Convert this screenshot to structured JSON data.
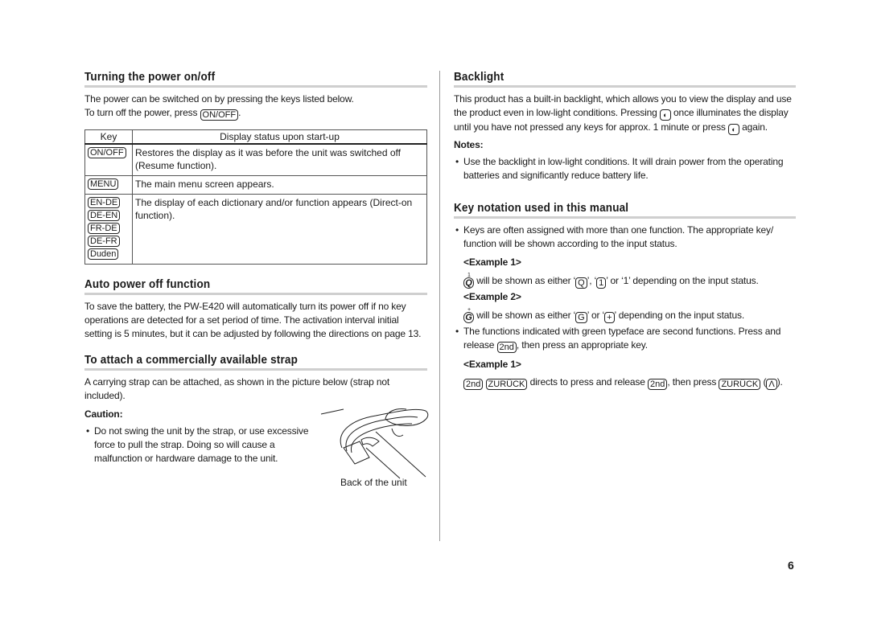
{
  "page_number": "6",
  "left": {
    "power": {
      "title": "Turning the power on/off",
      "line1": "The power can be switched on by pressing the keys listed below.",
      "line2_prefix": "To turn off the power, press",
      "line2_key": "ON/OFF",
      "line2_suffix": ".",
      "table": {
        "headers": [
          "Key",
          "Display status upon start-up"
        ],
        "rows": [
          {
            "keys": [
              "ON/OFF"
            ],
            "text": "Restores the display as it was before the unit was switched off (Resume function)."
          },
          {
            "keys": [
              "MENU"
            ],
            "text": "The main menu screen appears."
          },
          {
            "keys": [
              "EN-DE",
              "DE-EN",
              "FR-DE",
              "DE-FR",
              "Duden"
            ],
            "text": "The display of each dictionary and/or function appears (Direct-on function)."
          }
        ]
      }
    },
    "auto_off": {
      "title": "Auto power off function",
      "text": "To save the battery, the PW-E420 will automatically turn its power off if no key operations are detected for a set period of time. The activation interval initial setting is 5 minutes, but it can be adjusted by following the directions on page 13."
    },
    "strap": {
      "title": "To attach a commercially available strap",
      "text": "A carrying strap can be attached, as shown in the picture below (strap not included).",
      "caution_label": "Caution:",
      "caution_text": "Do not swing the unit by the strap, or use excessive force to pull the strap. Doing so will cause a malfunction or hardware damage to the unit.",
      "caption": "Back of the unit"
    }
  },
  "right": {
    "backlight": {
      "title": "Backlight",
      "p1": "This product has a built-in backlight, which allows you to view the display and use",
      "p2_prefix": "the product even in low-light conditions. Pressing",
      "p2_suffix": "once illuminates the display",
      "p3_prefix": "until you have not pressed any keys for approx. 1 minute or press",
      "p3_suffix": "again.",
      "notes_label": "Notes:",
      "note1": "Use the backlight in low-light conditions. It will drain power from the operating batteries and significantly reduce battery life."
    },
    "notation": {
      "title": "Key notation used in this manual",
      "bullet1": "Keys are often assigned with more than one function. The appropriate key/ function will be shown according to the input status.",
      "example1_label": "<Example 1>",
      "ex1_key": "Q",
      "ex1_sup": "1",
      "ex1_a": "will be shown as either ‘",
      "ex1_key2": "Q",
      "ex1_b": "’, ‘",
      "ex1_key3": "1",
      "ex1_c": "’ or ‘1’ depending on the input status.",
      "example2_label": "<Example 2>",
      "ex2_key": "G",
      "ex2_sup": "+",
      "ex2_a": "will be shown as either ‘",
      "ex2_key2": "G",
      "ex2_b": "’ or ‘",
      "ex2_key3": "+",
      "ex2_c": "’ depending on the input status.",
      "bullet2_a": "The functions indicated with green typeface are second functions. Press and release",
      "bullet2_key": "2nd",
      "bullet2_b": ", then press an appropriate key.",
      "example3_label": "<Example 1>",
      "ex3_key1": "2nd",
      "ex3_key2": "ZURÜCK",
      "ex3_a": "directs to press and release",
      "ex3_key3": "2nd",
      "ex3_b": ", then press",
      "ex3_key4": "ZURÜCK",
      "ex3_c": "(",
      "ex3_key5": "Λ",
      "ex3_d": ")."
    }
  }
}
